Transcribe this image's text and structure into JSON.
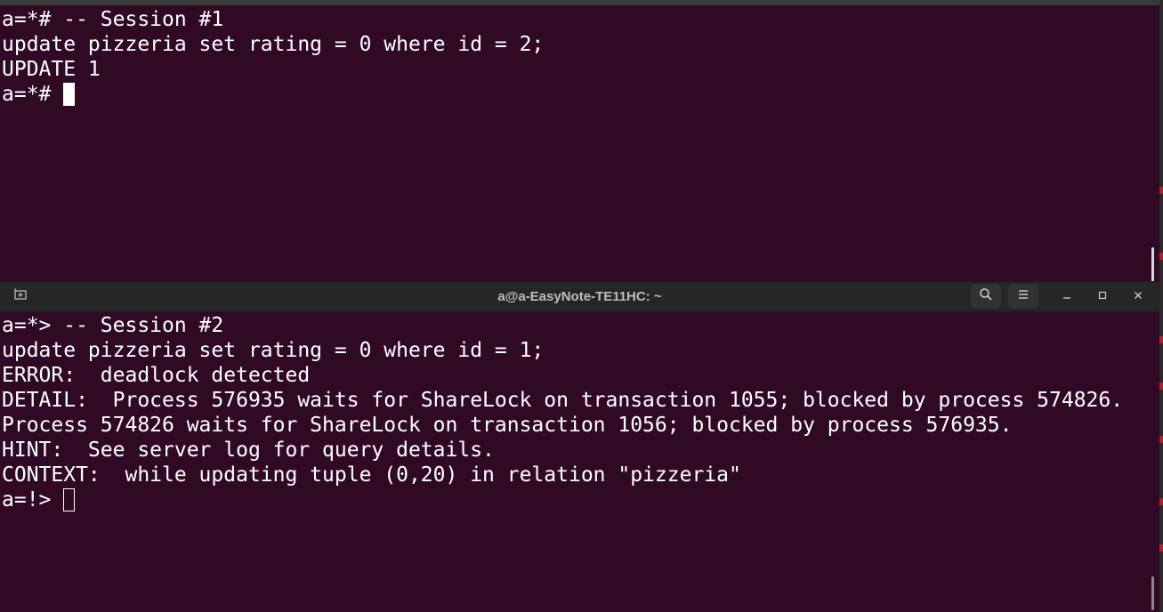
{
  "session1": {
    "lines": [
      "a=*# -- Session #1",
      "update pizzeria set rating = 0 where id = 2;",
      "UPDATE 1"
    ],
    "prompt": "a=*# "
  },
  "titlebar": {
    "title": "a@a-EasyNote-TE11HC: ~",
    "icons": [
      "new-tab-icon",
      "search-icon",
      "hamburger-menu-icon",
      "minimize-icon",
      "maximize-icon",
      "close-icon"
    ]
  },
  "session2": {
    "lines": [
      "a=*> -- Session #2",
      "update pizzeria set rating = 0 where id = 1;",
      "ERROR:  deadlock detected",
      "DETAIL:  Process 576935 waits for ShareLock on transaction 1055; blocked by process 574826.",
      "Process 574826 waits for ShareLock on transaction 1056; blocked by process 576935.",
      "HINT:  See server log for query details.",
      "CONTEXT:  while updating tuple (0,20) in relation \"pizzeria\""
    ],
    "prompt": "a=!> "
  },
  "colors": {
    "terminal_bg": "#300a24",
    "terminal_fg": "#ffffff",
    "titlebar_bg": "#262626",
    "title_fg": "#bdbdbd"
  }
}
